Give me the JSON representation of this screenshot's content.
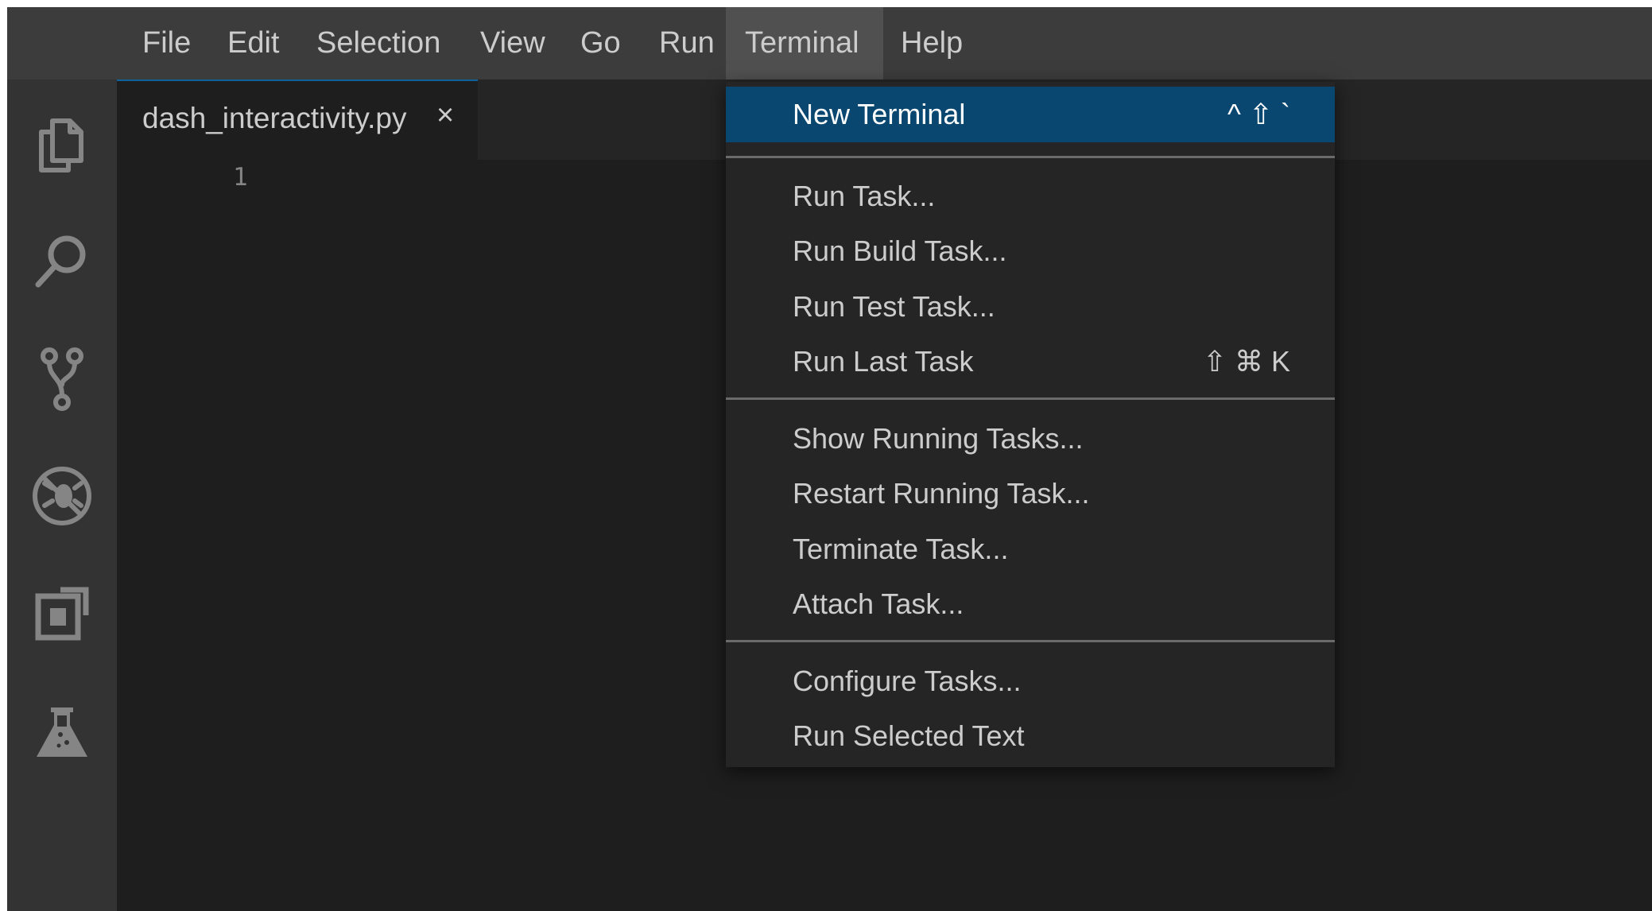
{
  "menubar": {
    "items": [
      {
        "label": "File"
      },
      {
        "label": "Edit"
      },
      {
        "label": "Selection"
      },
      {
        "label": "View"
      },
      {
        "label": "Go"
      },
      {
        "label": "Run"
      },
      {
        "label": "Terminal"
      },
      {
        "label": "Help"
      }
    ],
    "active": "Terminal"
  },
  "activitybar": {
    "icons": [
      "explorer-icon",
      "search-icon",
      "source-control-icon",
      "run-debug-icon",
      "extensions-icon",
      "testing-icon"
    ]
  },
  "editor": {
    "tab": {
      "label": "dash_interactivity.py",
      "close": "×"
    },
    "line_numbers": [
      "1"
    ]
  },
  "terminal_menu": {
    "items": [
      {
        "label": "New Terminal",
        "shortcut": "^ ⇧ `"
      },
      {
        "label": "Run Task...",
        "shortcut": ""
      },
      {
        "label": "Run Build Task...",
        "shortcut": ""
      },
      {
        "label": "Run Test Task...",
        "shortcut": ""
      },
      {
        "label": "Run Last Task",
        "shortcut": "⇧ ⌘ K"
      },
      {
        "label": "Show Running Tasks...",
        "shortcut": ""
      },
      {
        "label": "Restart Running Task...",
        "shortcut": ""
      },
      {
        "label": "Terminate Task...",
        "shortcut": ""
      },
      {
        "label": "Attach Task...",
        "shortcut": ""
      },
      {
        "label": "Configure Tasks...",
        "shortcut": ""
      },
      {
        "label": "Run Selected Text",
        "shortcut": ""
      }
    ],
    "highlighted": "New Terminal"
  },
  "colors": {
    "menubar_bg": "#3c3c3c",
    "activitybar_bg": "#333333",
    "editor_bg": "#1e1e1e",
    "menu_bg": "#252526",
    "highlight_bg": "#094771",
    "text": "#cccccc",
    "icon": "#858585"
  }
}
